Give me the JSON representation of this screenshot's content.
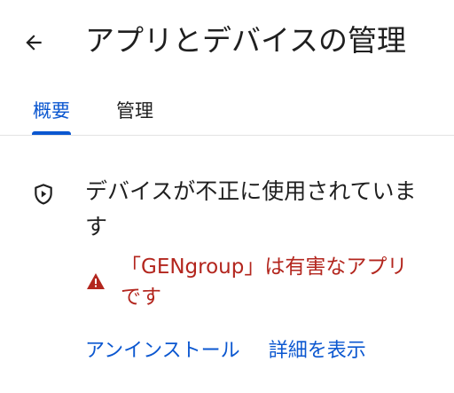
{
  "header": {
    "title": "アプリとデバイスの管理",
    "back_icon": "arrow-back-icon"
  },
  "tabs": [
    {
      "label": "概要",
      "selected": true
    },
    {
      "label": "管理",
      "selected": false
    }
  ],
  "status": {
    "icon": "shield-play-icon",
    "title": "デバイスが不正に使用されています",
    "warning_icon": "warning-triangle-icon",
    "warning_text": "「GENgroup」は有害なアプリです"
  },
  "actions": {
    "uninstall_label": "アンインストール",
    "details_label": "詳細を表示"
  },
  "colors": {
    "accent": "#0b57d0",
    "warning": "#b3261e",
    "text": "#1f1f1f"
  }
}
